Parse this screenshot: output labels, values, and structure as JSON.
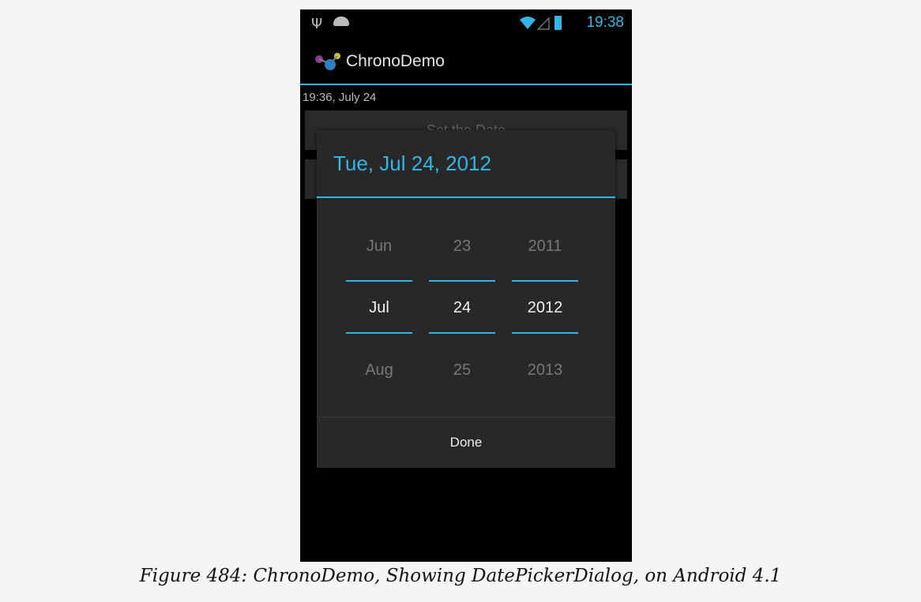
{
  "status_bar": {
    "time": "19:38",
    "accent_color": "#33b5e5",
    "icons": [
      "usb-icon",
      "android-debug-icon",
      "wifi-icon",
      "signal-icon",
      "battery-charging-icon"
    ]
  },
  "action_bar": {
    "app_icon": "chronodemo-app-icon",
    "title": "ChronoDemo"
  },
  "main": {
    "date_text": "19:36, July 24",
    "set_date_button": "Set the Date",
    "set_time_button": ""
  },
  "dialog": {
    "title": "Tue, Jul 24, 2012",
    "month": {
      "prev": "Jun",
      "current": "Jul",
      "next": "Aug"
    },
    "day": {
      "prev": "23",
      "current": "24",
      "next": "25"
    },
    "year": {
      "prev": "2011",
      "current": "2012",
      "next": "2013"
    },
    "done_label": "Done"
  },
  "caption": "Figure 484: ChronoDemo, Showing DatePickerDialog, on Android 4.1"
}
